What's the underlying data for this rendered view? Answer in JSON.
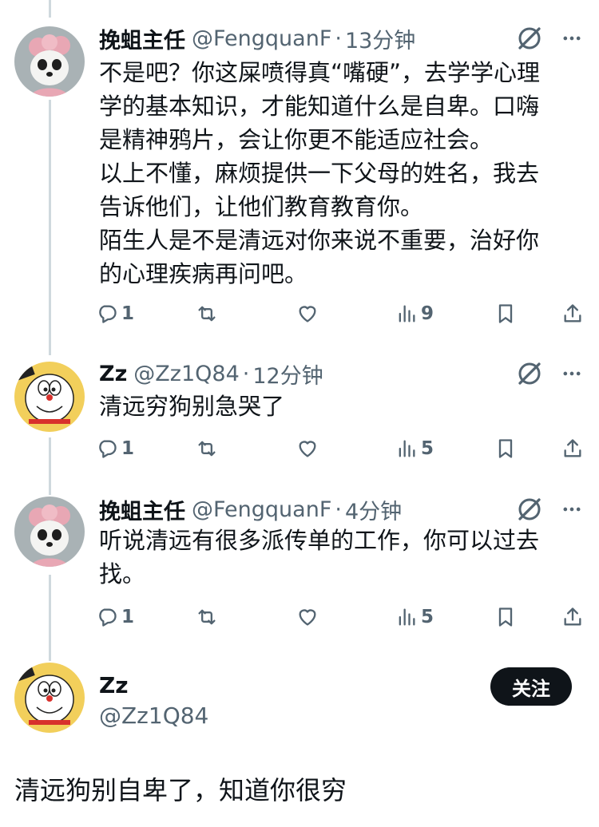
{
  "tweets": [
    {
      "name": "挽蛆主任",
      "handle": "@FengquanF",
      "time": "13分钟",
      "text": "不是吧？你这屎喷得真“嘴硬”，去学学心理\n学的基本知识，才能知道什么是自卑。口嗨\n是精神鸦片，会让你更不能适应社会。\n以上不懂，麻烦提供一下父母的姓名，我去\n告诉他们，让他们教育教育你。\n陌生人是不是清远对你来说不重要，治好你\n的心理疾病再问吧。",
      "replies": "1",
      "views": "9"
    },
    {
      "name": "Zz",
      "handle": "@Zz1Q84",
      "time": "12分钟",
      "text": "清远穷狗别急哭了",
      "replies": "1",
      "views": "5"
    },
    {
      "name": "挽蛆主任",
      "handle": "@FengquanF",
      "time": "4分钟",
      "text": "听说清远有很多派传单的工作，你可以过去\n找。",
      "replies": "1",
      "views": "5"
    }
  ],
  "separator": "·",
  "main": {
    "name": "Zz",
    "handle": "@Zz1Q84",
    "follow_label": "关注",
    "text": "清远狗别自卑了，知道你很穷"
  },
  "icons": [
    "grok-icon",
    "more-icon",
    "reply-icon",
    "retweet-icon",
    "like-icon",
    "views-icon",
    "bookmark-icon",
    "share-icon"
  ]
}
